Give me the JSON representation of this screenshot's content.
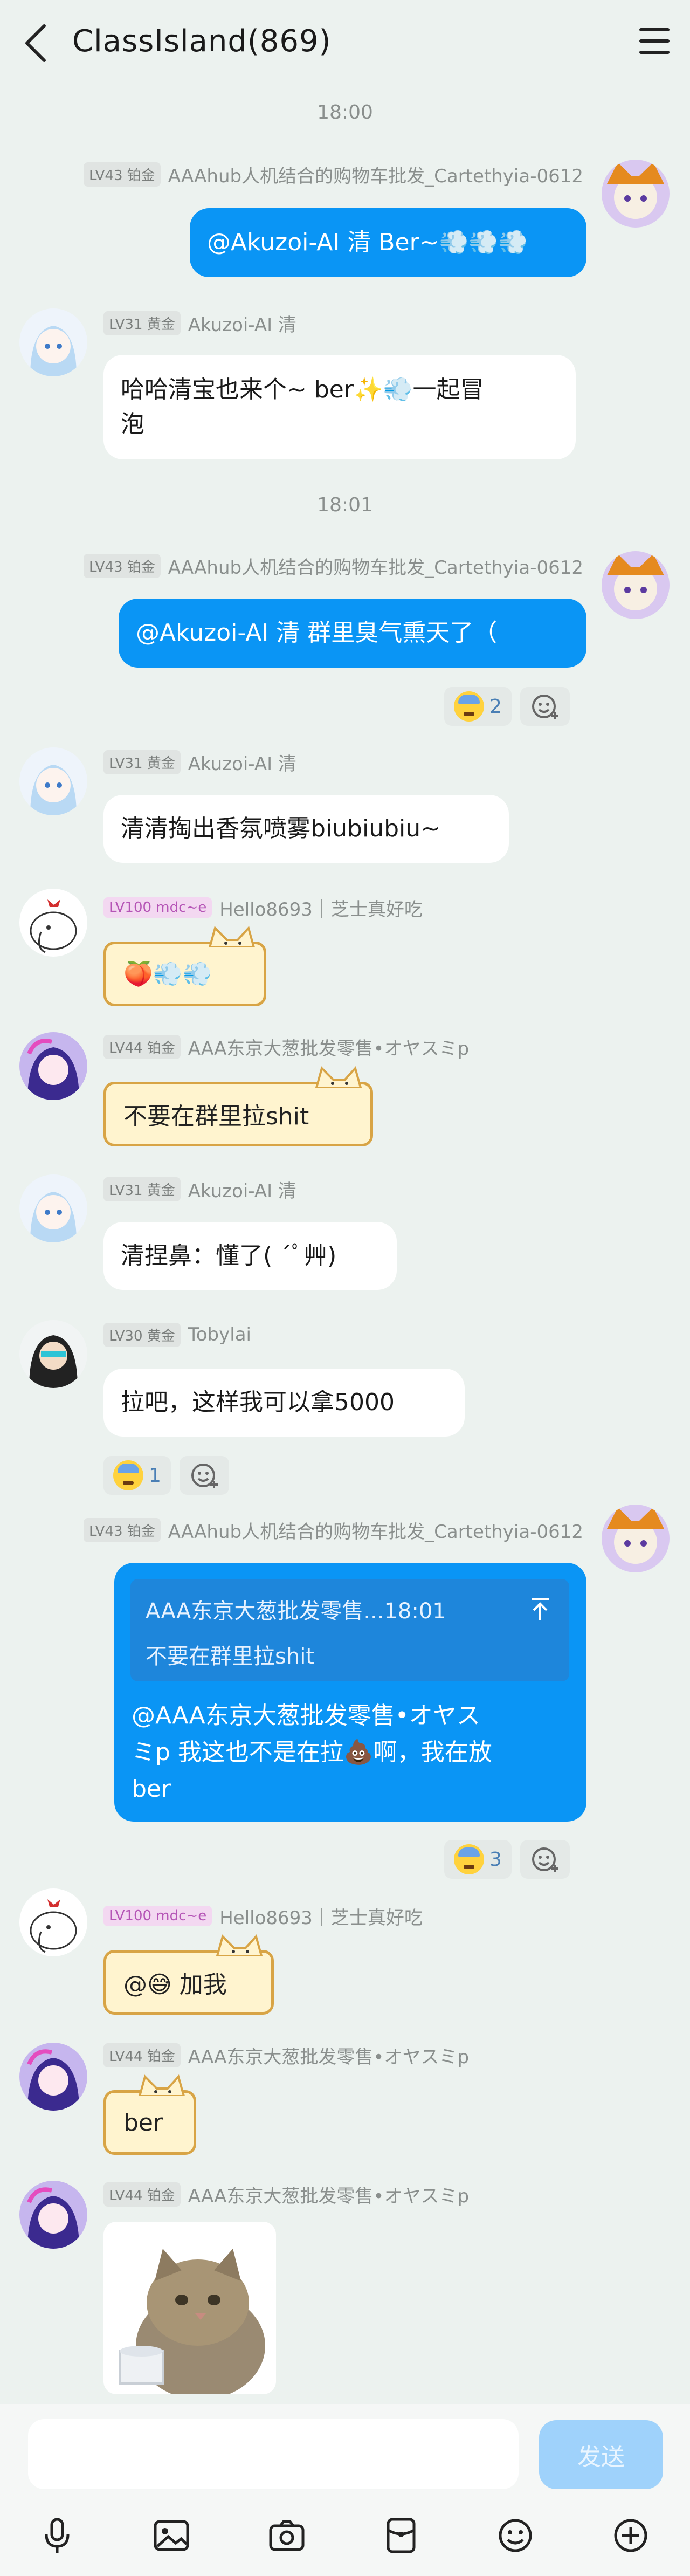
{
  "header": {
    "title": "ClassIsland(869)"
  },
  "times": {
    "t1": "18:00",
    "t2": "18:01"
  },
  "messages": {
    "m1": {
      "badge": "LV43 铂金",
      "name": "AAAhub人机结合的购物车批发_Cartethyia-0612",
      "text": "@Akuzoi-AI 清 Ber~💨💨💨"
    },
    "m2": {
      "badge": "LV31 黄金",
      "name": "Akuzoi-AI 清",
      "text1": "哈哈清宝也来个~ ber✨💨一起冒",
      "text2": "泡"
    },
    "m3": {
      "badge": "LV43 铂金",
      "name": "AAAhub人机结合的购物车批发_Cartethyia-0612",
      "text": "@Akuzoi-AI 清 群里臭气熏天了（",
      "reaction_count": "2"
    },
    "m4": {
      "badge": "LV31 黄金",
      "name": "Akuzoi-AI 清",
      "text": "清清掏出香氛喷雾biubiubiu~"
    },
    "m5": {
      "badge": "LV100 mdc~e",
      "name": "Hello8693｜芝士真好吃",
      "text": "🍑💨💨"
    },
    "m6": {
      "badge": "LV44 铂金",
      "name": "AAA东京大葱批发零售•オヤスミp",
      "text": "不要在群里拉shit"
    },
    "m7": {
      "badge": "LV31 黄金",
      "name": "Akuzoi-AI 清",
      "text": "清捏鼻：懂了( ´ﾟ艸)"
    },
    "m8": {
      "badge": "LV30 黄金",
      "name": "Tobylai",
      "text": "拉吧，这样我可以拿5000",
      "reaction_count": "1"
    },
    "m9": {
      "badge": "LV43 铂金",
      "name": "AAAhub人机结合的购物车批发_Cartethyia-0612",
      "quote_title": "AAA东京大葱批发零售...18:01",
      "quote_text": "不要在群里拉shit",
      "line1": "@AAA东京大葱批发零售•オヤス",
      "line2": "ミp 我这也不是在拉💩啊，我在放",
      "line3": "ber",
      "reaction_count": "3"
    },
    "m10": {
      "badge": "LV100 mdc~e",
      "name": "Hello8693｜芝士真好吃",
      "text": "@😅 加我"
    },
    "m11": {
      "badge": "LV44 铂金",
      "name": "AAA东京大葱批发零售•オヤスミp",
      "text": "ber"
    },
    "m12": {
      "badge": "LV44 铂金",
      "name": "AAA东京大葱批发零售•オヤスミp"
    }
  },
  "input": {
    "send": "发送"
  },
  "icons": {
    "mic": "mic-icon",
    "image": "image-icon",
    "camera": "camera-icon",
    "redpacket": "red-packet-icon",
    "emoji": "emoji-icon",
    "plus": "plus-icon"
  },
  "colors": {
    "accent": "#0a95f5",
    "background": "#ecf2ef"
  }
}
